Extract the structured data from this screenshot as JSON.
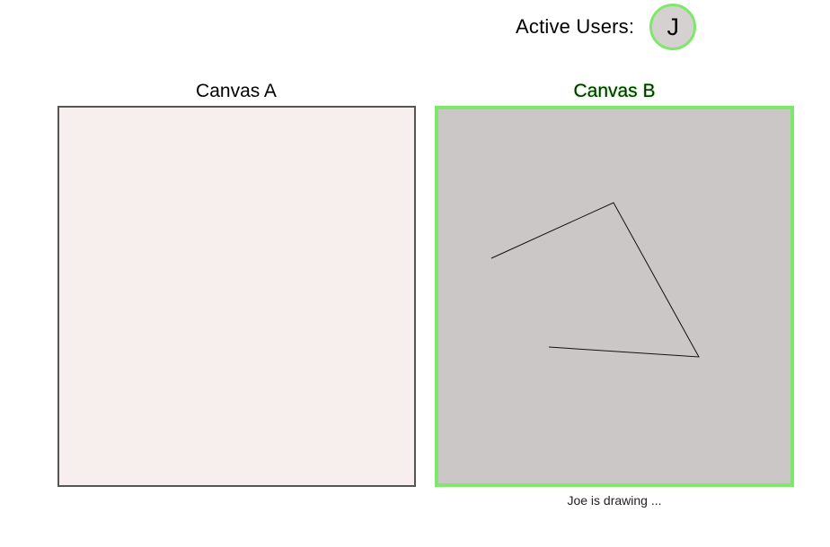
{
  "header": {
    "active_users_label": "Active Users:",
    "users": [
      {
        "initial": "J",
        "highlight_color": "#7ee86b"
      }
    ]
  },
  "canvases": [
    {
      "title": "Canvas A",
      "background": "#f7efee",
      "active": false
    },
    {
      "title": "Canvas B",
      "background": "#ccc7c7",
      "active": true,
      "highlight_color": "#7ee86b"
    }
  ],
  "status": {
    "drawing_text": "Joe is drawing ..."
  }
}
